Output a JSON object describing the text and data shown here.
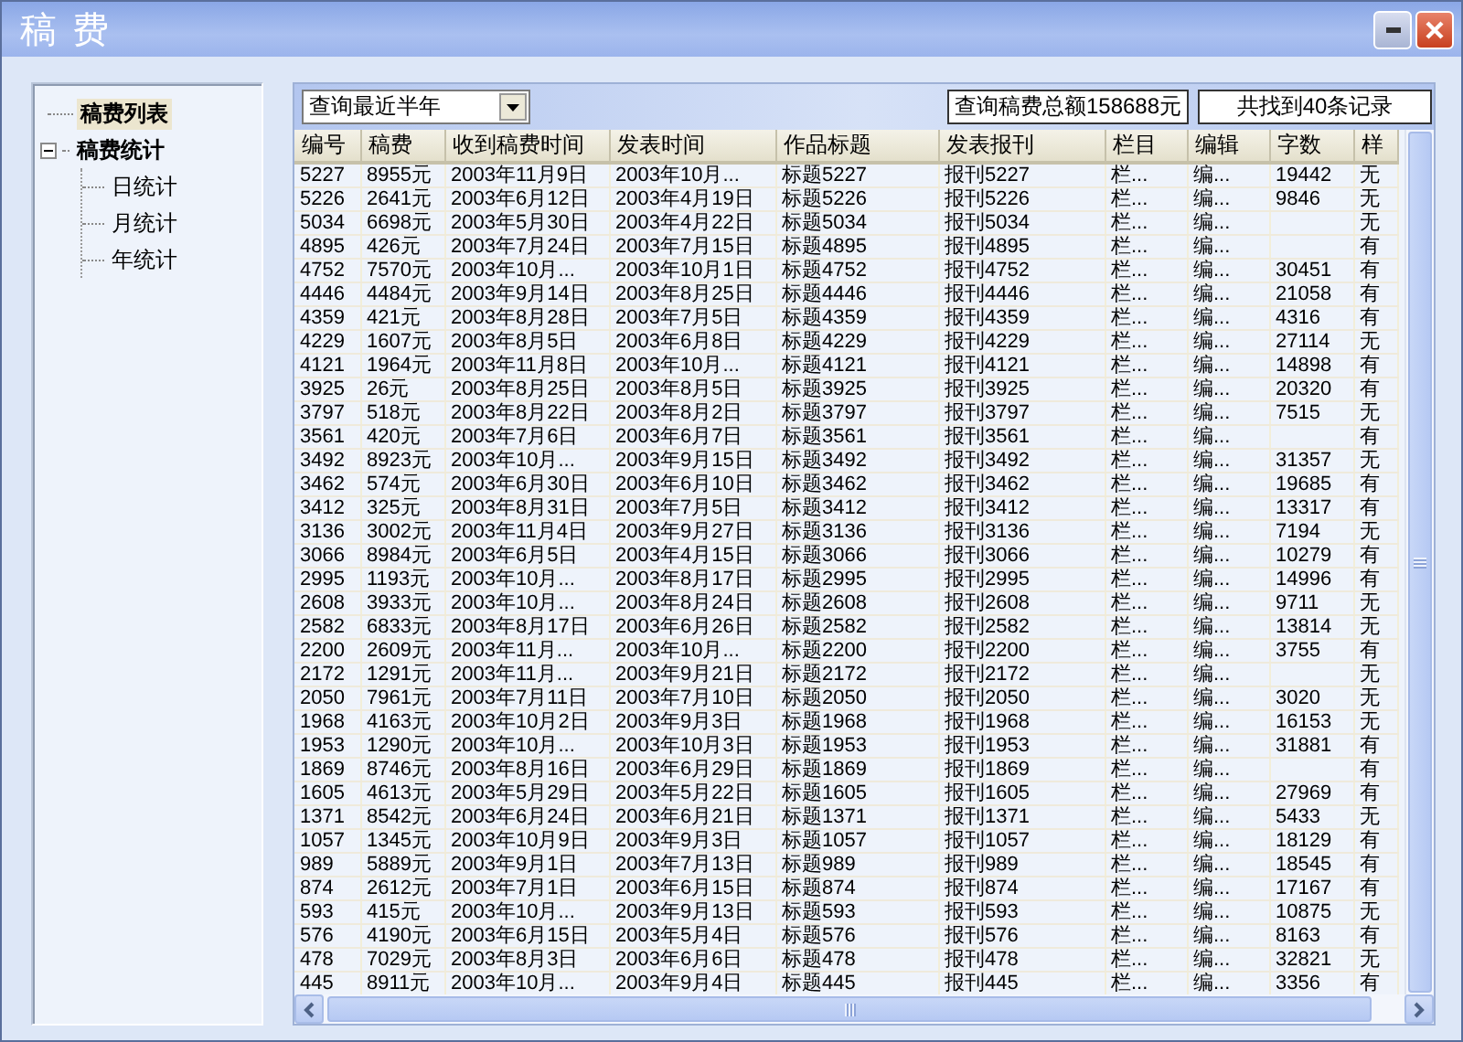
{
  "window": {
    "title": "稿 费"
  },
  "tree": [
    {
      "label": "稿费列表",
      "selected": true
    },
    {
      "label": "稿费统计",
      "selected": false,
      "expanded": true,
      "children": [
        {
          "label": "日统计",
          "selected": false
        },
        {
          "label": "月统计",
          "selected": false
        },
        {
          "label": "年统计",
          "selected": false
        }
      ]
    }
  ],
  "toolbar": {
    "query": {
      "value": "查询最近半年"
    },
    "total": "查询稿费总额158688元",
    "count": "共找到40条记录"
  },
  "table": {
    "columns": [
      "编号",
      "稿费",
      "收到稿费时间",
      "发表时间",
      "作品标题",
      "发表报刊",
      "栏目",
      "编辑",
      "字数",
      "样"
    ],
    "rows": [
      {
        "no": "5227",
        "fee": "8955元",
        "received": "2003年11月9日",
        "published": "2003年10月...",
        "title": "标题5227",
        "journal": "报刊5227",
        "column": "栏...",
        "editor": "编...",
        "words": "19442",
        "sample": "无"
      },
      {
        "no": "5226",
        "fee": "2641元",
        "received": "2003年6月12日",
        "published": "2003年4月19日",
        "title": "标题5226",
        "journal": "报刊5226",
        "column": "栏...",
        "editor": "编...",
        "words": "9846",
        "sample": "无"
      },
      {
        "no": "5034",
        "fee": "6698元",
        "received": "2003年5月30日",
        "published": "2003年4月22日",
        "title": "标题5034",
        "journal": "报刊5034",
        "column": "栏...",
        "editor": "编...",
        "sample": "无"
      },
      {
        "no": "4895",
        "fee": "426元",
        "received": "2003年7月24日",
        "published": "2003年7月15日",
        "title": "标题4895",
        "journal": "报刊4895",
        "column": "栏...",
        "editor": "编...",
        "sample": "有"
      },
      {
        "no": "4752",
        "fee": "7570元",
        "received": "2003年10月...",
        "published": "2003年10月1日",
        "title": "标题4752",
        "journal": "报刊4752",
        "column": "栏...",
        "editor": "编...",
        "words": "30451",
        "sample": "有"
      },
      {
        "no": "4446",
        "fee": "4484元",
        "received": "2003年9月14日",
        "published": "2003年8月25日",
        "title": "标题4446",
        "journal": "报刊4446",
        "column": "栏...",
        "editor": "编...",
        "words": "21058",
        "sample": "有"
      },
      {
        "no": "4359",
        "fee": "421元",
        "received": "2003年8月28日",
        "published": "2003年7月5日",
        "title": "标题4359",
        "journal": "报刊4359",
        "column": "栏...",
        "editor": "编...",
        "words": "4316",
        "sample": "有"
      },
      {
        "no": "4229",
        "fee": "1607元",
        "received": "2003年8月5日",
        "published": "2003年6月8日",
        "title": "标题4229",
        "journal": "报刊4229",
        "column": "栏...",
        "editor": "编...",
        "words": "27114",
        "sample": "无"
      },
      {
        "no": "4121",
        "fee": "1964元",
        "received": "2003年11月8日",
        "published": "2003年10月...",
        "title": "标题4121",
        "journal": "报刊4121",
        "column": "栏...",
        "editor": "编...",
        "words": "14898",
        "sample": "有"
      },
      {
        "no": "3925",
        "fee": "26元",
        "received": "2003年8月25日",
        "published": "2003年8月5日",
        "title": "标题3925",
        "journal": "报刊3925",
        "column": "栏...",
        "editor": "编...",
        "words": "20320",
        "sample": "有"
      },
      {
        "no": "3797",
        "fee": "518元",
        "received": "2003年8月22日",
        "published": "2003年8月2日",
        "title": "标题3797",
        "journal": "报刊3797",
        "column": "栏...",
        "editor": "编...",
        "words": "7515",
        "sample": "无"
      },
      {
        "no": "3561",
        "fee": "420元",
        "received": "2003年7月6日",
        "published": "2003年6月7日",
        "title": "标题3561",
        "journal": "报刊3561",
        "column": "栏...",
        "editor": "编...",
        "sample": "有"
      },
      {
        "no": "3492",
        "fee": "8923元",
        "received": "2003年10月...",
        "published": "2003年9月15日",
        "title": "标题3492",
        "journal": "报刊3492",
        "column": "栏...",
        "editor": "编...",
        "words": "31357",
        "sample": "无"
      },
      {
        "no": "3462",
        "fee": "574元",
        "received": "2003年6月30日",
        "published": "2003年6月10日",
        "title": "标题3462",
        "journal": "报刊3462",
        "column": "栏...",
        "editor": "编...",
        "words": "19685",
        "sample": "有"
      },
      {
        "no": "3412",
        "fee": "325元",
        "received": "2003年8月31日",
        "published": "2003年7月5日",
        "title": "标题3412",
        "journal": "报刊3412",
        "column": "栏...",
        "editor": "编...",
        "words": "13317",
        "sample": "有"
      },
      {
        "no": "3136",
        "fee": "3002元",
        "received": "2003年11月4日",
        "published": "2003年9月27日",
        "title": "标题3136",
        "journal": "报刊3136",
        "column": "栏...",
        "editor": "编...",
        "words": "7194",
        "sample": "无"
      },
      {
        "no": "3066",
        "fee": "8984元",
        "received": "2003年6月5日",
        "published": "2003年4月15日",
        "title": "标题3066",
        "journal": "报刊3066",
        "column": "栏...",
        "editor": "编...",
        "words": "10279",
        "sample": "有"
      },
      {
        "no": "2995",
        "fee": "1193元",
        "received": "2003年10月...",
        "published": "2003年8月17日",
        "title": "标题2995",
        "journal": "报刊2995",
        "column": "栏...",
        "editor": "编...",
        "words": "14996",
        "sample": "有"
      },
      {
        "no": "2608",
        "fee": "3933元",
        "received": "2003年10月...",
        "published": "2003年8月24日",
        "title": "标题2608",
        "journal": "报刊2608",
        "column": "栏...",
        "editor": "编...",
        "words": "9711",
        "sample": "无"
      },
      {
        "no": "2582",
        "fee": "6833元",
        "received": "2003年8月17日",
        "published": "2003年6月26日",
        "title": "标题2582",
        "journal": "报刊2582",
        "column": "栏...",
        "editor": "编...",
        "words": "13814",
        "sample": "无"
      },
      {
        "no": "2200",
        "fee": "2609元",
        "received": "2003年11月...",
        "published": "2003年10月...",
        "title": "标题2200",
        "journal": "报刊2200",
        "column": "栏...",
        "editor": "编...",
        "words": "3755",
        "sample": "有"
      },
      {
        "no": "2172",
        "fee": "1291元",
        "received": "2003年11月...",
        "published": "2003年9月21日",
        "title": "标题2172",
        "journal": "报刊2172",
        "column": "栏...",
        "editor": "编...",
        "sample": "无"
      },
      {
        "no": "2050",
        "fee": "7961元",
        "received": "2003年7月11日",
        "published": "2003年7月10日",
        "title": "标题2050",
        "journal": "报刊2050",
        "column": "栏...",
        "editor": "编...",
        "words": "3020",
        "sample": "无"
      },
      {
        "no": "1968",
        "fee": "4163元",
        "received": "2003年10月2日",
        "published": "2003年9月3日",
        "title": "标题1968",
        "journal": "报刊1968",
        "column": "栏...",
        "editor": "编...",
        "words": "16153",
        "sample": "无"
      },
      {
        "no": "1953",
        "fee": "1290元",
        "received": "2003年10月...",
        "published": "2003年10月3日",
        "title": "标题1953",
        "journal": "报刊1953",
        "column": "栏...",
        "editor": "编...",
        "words": "31881",
        "sample": "有"
      },
      {
        "no": "1869",
        "fee": "8746元",
        "received": "2003年8月16日",
        "published": "2003年6月29日",
        "title": "标题1869",
        "journal": "报刊1869",
        "column": "栏...",
        "editor": "编...",
        "sample": "有"
      },
      {
        "no": "1605",
        "fee": "4613元",
        "received": "2003年5月29日",
        "published": "2003年5月22日",
        "title": "标题1605",
        "journal": "报刊1605",
        "column": "栏...",
        "editor": "编...",
        "words": "27969",
        "sample": "有"
      },
      {
        "no": "1371",
        "fee": "8542元",
        "received": "2003年6月24日",
        "published": "2003年6月21日",
        "title": "标题1371",
        "journal": "报刊1371",
        "column": "栏...",
        "editor": "编...",
        "words": "5433",
        "sample": "无"
      },
      {
        "no": "1057",
        "fee": "1345元",
        "received": "2003年10月9日",
        "published": "2003年9月3日",
        "title": "标题1057",
        "journal": "报刊1057",
        "column": "栏...",
        "editor": "编...",
        "words": "18129",
        "sample": "有"
      },
      {
        "no": "989",
        "fee": "5889元",
        "received": "2003年9月1日",
        "published": "2003年7月13日",
        "title": "标题989",
        "journal": "报刊989",
        "column": "栏...",
        "editor": "编...",
        "words": "18545",
        "sample": "有"
      },
      {
        "no": "874",
        "fee": "2612元",
        "received": "2003年7月1日",
        "published": "2003年6月15日",
        "title": "标题874",
        "journal": "报刊874",
        "column": "栏...",
        "editor": "编...",
        "words": "17167",
        "sample": "有"
      },
      {
        "no": "593",
        "fee": "415元",
        "received": "2003年10月...",
        "published": "2003年9月13日",
        "title": "标题593",
        "journal": "报刊593",
        "column": "栏...",
        "editor": "编...",
        "words": "10875",
        "sample": "无"
      },
      {
        "no": "576",
        "fee": "4190元",
        "received": "2003年6月15日",
        "published": "2003年5月4日",
        "title": "标题576",
        "journal": "报刊576",
        "column": "栏...",
        "editor": "编...",
        "words": "8163",
        "sample": "有"
      },
      {
        "no": "478",
        "fee": "7029元",
        "received": "2003年8月3日",
        "published": "2003年6月6日",
        "title": "标题478",
        "journal": "报刊478",
        "column": "栏...",
        "editor": "编...",
        "words": "32821",
        "sample": "无"
      },
      {
        "no": "445",
        "fee": "8911元",
        "received": "2003年10月...",
        "published": "2003年9月4日",
        "title": "标题445",
        "journal": "报刊445",
        "column": "栏...",
        "editor": "编...",
        "words": "3356",
        "sample": "有"
      }
    ]
  }
}
